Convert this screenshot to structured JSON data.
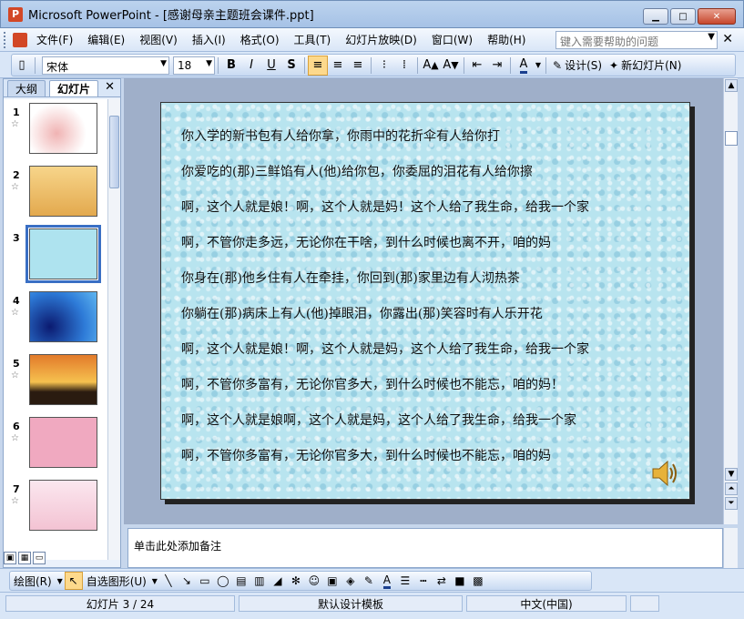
{
  "window": {
    "title": "Microsoft PowerPoint - [感谢母亲主题班会课件.ppt]",
    "app_icon": "P"
  },
  "menu": {
    "items": [
      "文件(F)",
      "编辑(E)",
      "视图(V)",
      "插入(I)",
      "格式(O)",
      "工具(T)",
      "幻灯片放映(D)",
      "窗口(W)",
      "帮助(H)"
    ],
    "help_placeholder": "键入需要帮助的问题"
  },
  "toolbar": {
    "font": "宋体",
    "size": "18",
    "design_label": "设计(S)",
    "new_slide_label": "新幻灯片(N)"
  },
  "left_panel": {
    "tabs": [
      "大纲",
      "幻灯片"
    ],
    "active_tab": "幻灯片",
    "slides": [
      {
        "num": "1",
        "mark": "☆"
      },
      {
        "num": "2",
        "mark": "☆"
      },
      {
        "num": "3",
        "mark": ""
      },
      {
        "num": "4",
        "mark": "☆"
      },
      {
        "num": "5",
        "mark": "☆"
      },
      {
        "num": "6",
        "mark": "☆"
      },
      {
        "num": "7",
        "mark": "☆"
      }
    ],
    "selected_slide": 3
  },
  "slide": {
    "lines": [
      "你入学的新书包有人给你拿，你雨中的花折伞有人给你打",
      "你爱吃的(那)三鲜馅有人(他)给你包，你委屈的泪花有人给你擦",
      "啊，这个人就是娘！啊，这个人就是妈！这个人给了我生命，给我一个家",
      "啊，不管你走多远，无论你在干啥，到什么时候也离不开，咱的妈",
      "你身在(那)他乡住有人在牵挂，你回到(那)家里边有人沏热茶",
      "你躺在(那)病床上有人(他)掉眼泪，你露出(那)笑容时有人乐开花",
      "啊，这个人就是娘！啊，这个人就是妈，这个人给了我生命，给我一个家",
      "啊，不管你多富有，无论你官多大，到什么时候也不能忘，咱的妈！",
      "啊，这个人就是娘啊，这个人就是妈，这个人给了我生命，给我一个家",
      "啊，不管你多富有，无论你官多大，到什么时候也不能忘，咱的妈"
    ]
  },
  "notes": {
    "placeholder": "单击此处添加备注"
  },
  "draw_toolbar": {
    "draw_label": "绘图(R)",
    "autoshape_label": "自选图形(U)"
  },
  "status": {
    "slide_info": "幻灯片 3 / 24",
    "template": "默认设计模板",
    "language": "中文(中国)"
  }
}
